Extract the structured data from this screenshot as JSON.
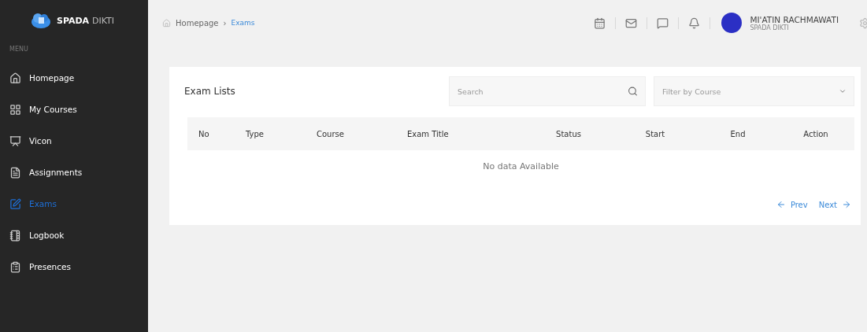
{
  "brand": {
    "name": "SPADA",
    "suffix": "DIKTI"
  },
  "menu_label": "MENU",
  "sidebar": {
    "items": [
      {
        "label": "Homepage",
        "kind": "home",
        "selected": false
      },
      {
        "label": "My Courses",
        "kind": "grid",
        "selected": false
      },
      {
        "label": "Vicon",
        "kind": "screen",
        "selected": false
      },
      {
        "label": "Assignments",
        "kind": "doc",
        "selected": false
      },
      {
        "label": "Exams",
        "kind": "edit",
        "selected": true
      },
      {
        "label": "Logbook",
        "kind": "book",
        "selected": false
      },
      {
        "label": "Presences",
        "kind": "list",
        "selected": false
      }
    ]
  },
  "breadcrumb_separator": "›",
  "breadcrumb": [
    {
      "label": "Homepage",
      "current": false
    },
    {
      "label": "Exams",
      "current": true
    }
  ],
  "header_icons": [
    {
      "kind": "calendar"
    },
    {
      "kind": "mail"
    },
    {
      "kind": "chat"
    },
    {
      "kind": "bell"
    }
  ],
  "user": {
    "name": "MI'ATIN RACHMAWATI",
    "role": "SPADA DIKTI"
  },
  "card": {
    "title": "Exam Lists",
    "search": {
      "placeholder": "Search"
    },
    "filter": {
      "placeholder": "Filter by Course"
    }
  },
  "table": {
    "columns": [
      "No",
      "Type",
      "Course",
      "Exam Title",
      "Status",
      "Start",
      "End",
      "Action"
    ],
    "empty": "No data Available"
  },
  "pagination": {
    "prev": "Prev",
    "next": "Next"
  }
}
